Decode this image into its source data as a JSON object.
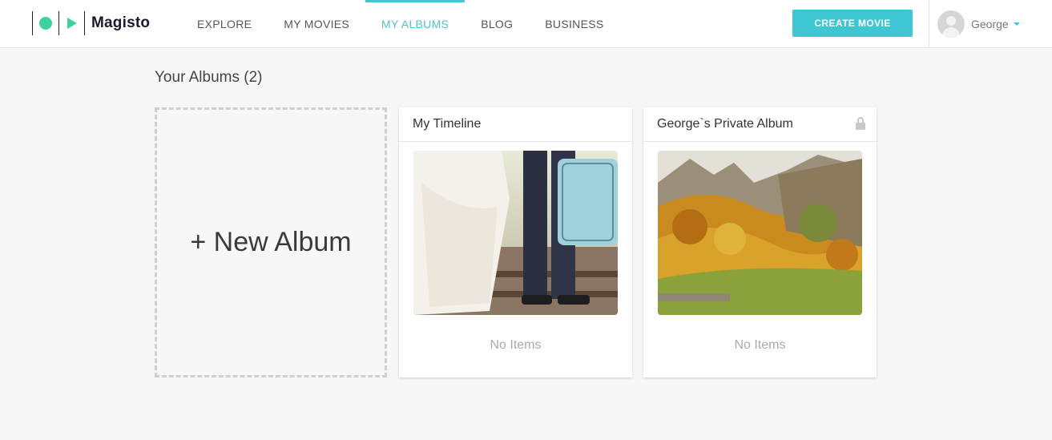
{
  "header": {
    "brand": "Magisto",
    "nav": [
      {
        "label": "EXPLORE",
        "active": false
      },
      {
        "label": "MY MOVIES",
        "active": false
      },
      {
        "label": "MY ALBUMS",
        "active": true
      },
      {
        "label": "BLOG",
        "active": false
      },
      {
        "label": "BUSINESS",
        "active": false
      }
    ],
    "create_label": "CREATE MOVIE",
    "user_name": "George"
  },
  "colors": {
    "accent": "#3fc6d3",
    "logo_green": "#3ad29f"
  },
  "main": {
    "title": "Your Albums (2)",
    "new_album_label": "+ New Album",
    "albums": [
      {
        "title": "My Timeline",
        "status": "No Items",
        "private": false,
        "image": "wedding-photo"
      },
      {
        "title": "George`s Private Album",
        "status": "No Items",
        "private": true,
        "image": "autumn-mountain-photo"
      }
    ]
  }
}
